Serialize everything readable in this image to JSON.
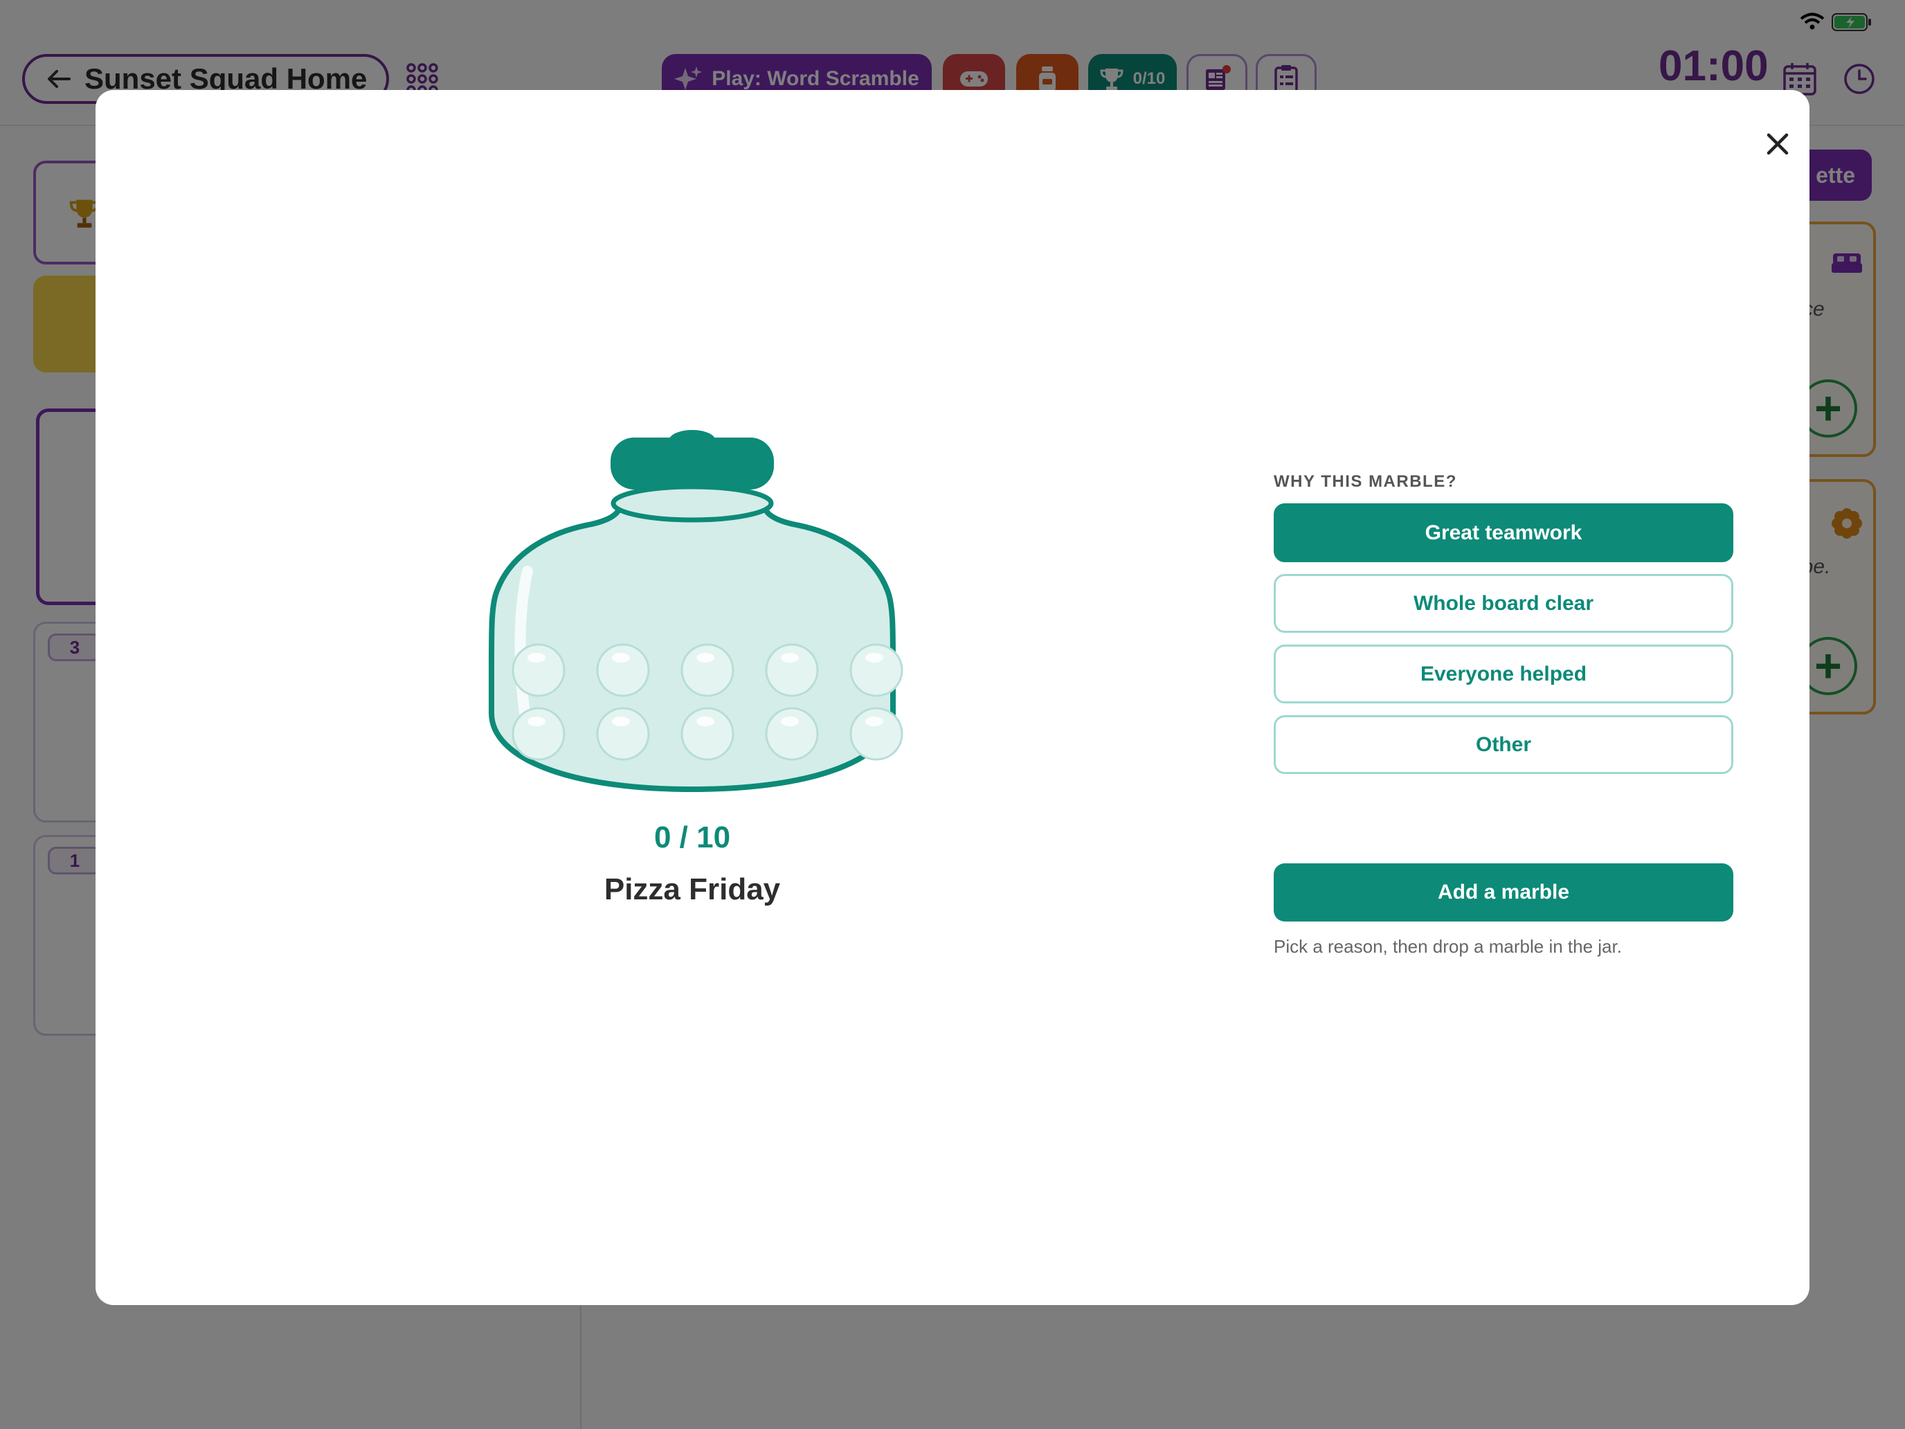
{
  "app": {
    "back_label": "Sunset Squad Home",
    "play_label": "Play: Word Scramble",
    "jar_progress_badge": "0/10",
    "timer": "01:00",
    "left_counts": [
      "3",
      "1"
    ],
    "right_button_fragment": "ette",
    "right_text_fragments": [
      "ce",
      "ibe."
    ]
  },
  "modal": {
    "jar": {
      "count_text": "0 / 10",
      "current": 0,
      "capacity": 10,
      "title": "Pizza Friday"
    },
    "reason_heading": "WHY THIS MARBLE?",
    "reasons": [
      {
        "label": "Great teamwork",
        "selected": true
      },
      {
        "label": "Whole board clear",
        "selected": false
      },
      {
        "label": "Everyone helped",
        "selected": false
      },
      {
        "label": "Other",
        "selected": false
      }
    ],
    "add_button_label": "Add a marble",
    "hint": "Pick a reason, then drop a marble in the jar."
  },
  "colors": {
    "teal": "#0d8a78",
    "purple": "#6f2c91",
    "overlay": "rgba(0,0,0,0.5)"
  }
}
